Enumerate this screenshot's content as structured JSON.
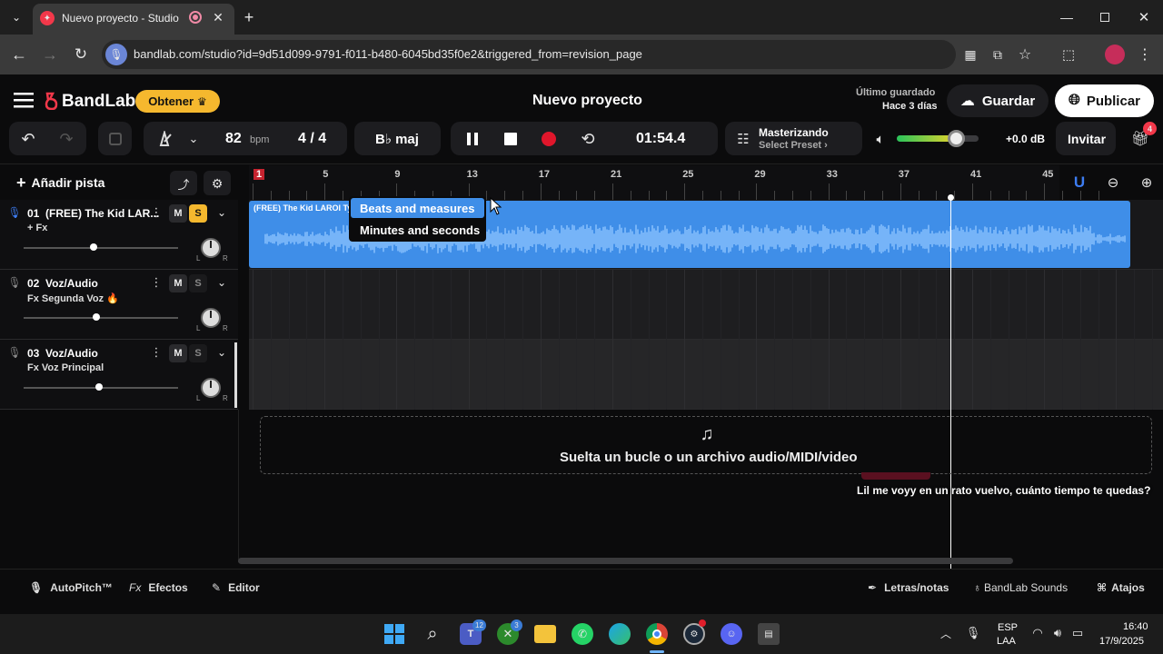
{
  "browser": {
    "tab_title": "Nuevo proyecto - Studio",
    "url": "bandlab.com/studio?id=9d51d099-9791-f011-b480-6045bd35f0e2&triggered_from=revision_page"
  },
  "header": {
    "brand": "BandLab",
    "obtener_label": "Obtener",
    "project_title": "Nuevo proyecto",
    "saved_label": "Último guardado",
    "saved_time": "Hace 3 días",
    "save_label": "Guardar",
    "publish_label": "Publicar"
  },
  "toolbar": {
    "bpm_value": "82",
    "bpm_unit": "bpm",
    "time_sig": "4 / 4",
    "key": "B♭ maj",
    "time": "01:54.4",
    "mastering_title": "Masterizando",
    "mastering_preset": "Select Preset",
    "volume_db": "+0.0 dB",
    "volume_level": 0.72,
    "invite_label": "Invitar",
    "gift_badge": "4"
  },
  "tracks_panel": {
    "add_track_label": "Añadir pista"
  },
  "tracks": [
    {
      "number": "01",
      "name": "(FREE) The Kid LAR...",
      "fx": "+ Fx",
      "mute": "M",
      "solo": "S",
      "solo_active": true,
      "volume": 0.73
    },
    {
      "number": "02",
      "name": "Voz/Audio",
      "fx": "Fx Segunda Voz 🔥",
      "mute": "M",
      "solo": "S",
      "solo_active": false,
      "volume": 0.75
    },
    {
      "number": "03",
      "name": "Voz/Audio",
      "fx": "Fx Voz Principal",
      "mute": "M",
      "solo": "S",
      "solo_active": false,
      "volume": 0.78
    }
  ],
  "ruler": {
    "markers": [
      "1",
      "5",
      "9",
      "13",
      "17",
      "21",
      "25",
      "29",
      "33",
      "37",
      "41",
      "45"
    ]
  },
  "clip": {
    "label": "(FREE) The Kid LAROI Typ"
  },
  "menu": {
    "options": [
      "Beats and measures",
      "Minutes and seconds"
    ],
    "selected": "Beats and measures"
  },
  "drop_zone": {
    "text": "Suelta un bucle o un archivo audio/MIDI/video"
  },
  "caption": "Lil me voyy en un rato vuelvo, cuánto tiempo te quedas?",
  "bottom_bar": {
    "autopitch": "AutoPitch™",
    "effects": "Efectos",
    "effects_prefix": "Fx",
    "editor": "Editor",
    "lyrics": "Letras/notas",
    "sounds": "BandLab Sounds",
    "shortcuts": "Atajos"
  },
  "taskbar": {
    "lang_line1": "ESP",
    "lang_line2": "LAA",
    "time": "16:40",
    "date": "17/9/2025",
    "badge_teams": "12",
    "badge_xbox": "3"
  }
}
